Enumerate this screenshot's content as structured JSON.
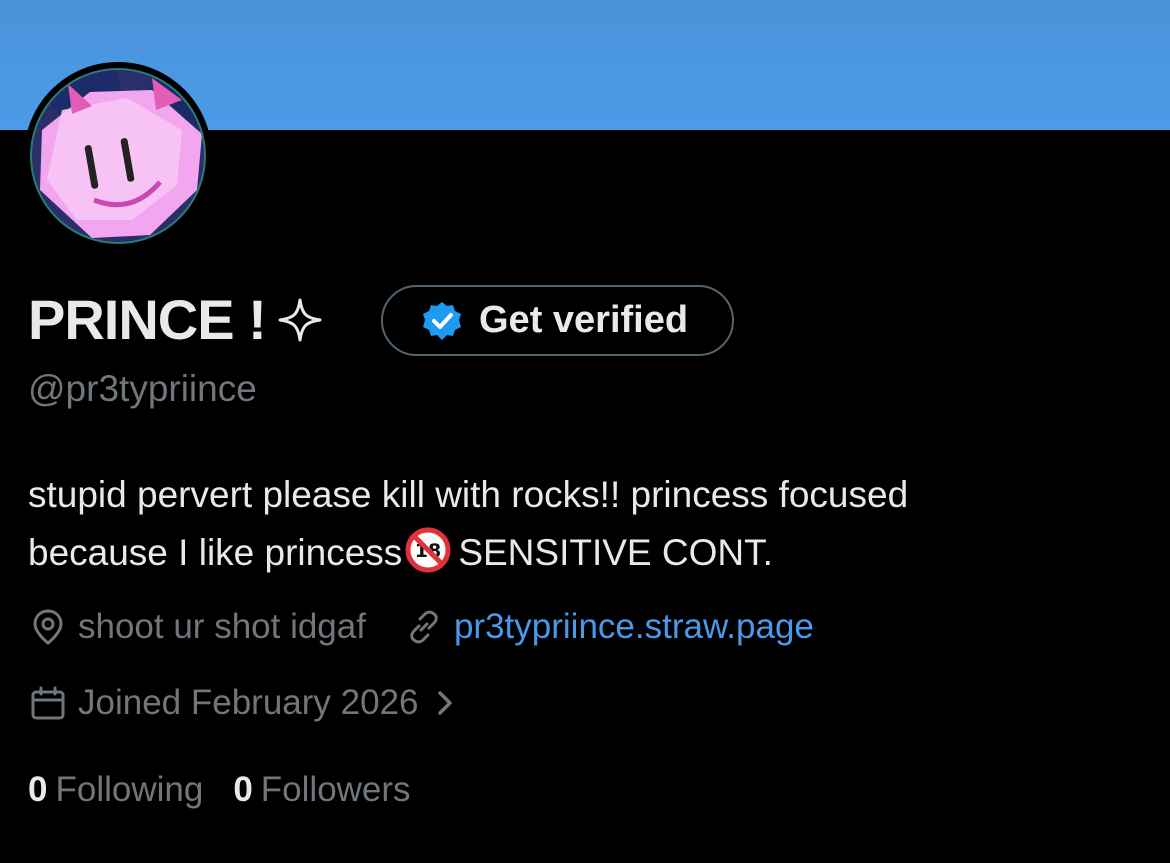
{
  "profile": {
    "display_name": "PRINCE !",
    "handle": "@pr3typriince",
    "bio_line1": "stupid pervert please kill with rocks!! princess focused",
    "bio_line2a": "because I like princess",
    "bio_line2b": "SENSITIVE CONT.",
    "location": "shoot ur shot idgaf",
    "website": "pr3typriince.straw.page",
    "joined": "Joined February 2026",
    "following_count": "0",
    "following_label": "Following",
    "followers_count": "0",
    "followers_label": "Followers"
  },
  "verify_button": {
    "label": "Get verified"
  },
  "icons": {
    "sparkle": "sparkle-icon",
    "verified": "verified-badge-icon",
    "adult": "no-under-18-icon",
    "location": "location-pin-icon",
    "link": "link-icon",
    "calendar": "calendar-icon",
    "chevron": "chevron-right-icon"
  },
  "colors": {
    "banner": "#4c9be8",
    "background": "#000000",
    "text_primary": "#e7e9ea",
    "text_secondary": "#71767b",
    "link": "#4a99e9",
    "verified_blue": "#1d9bf0"
  }
}
